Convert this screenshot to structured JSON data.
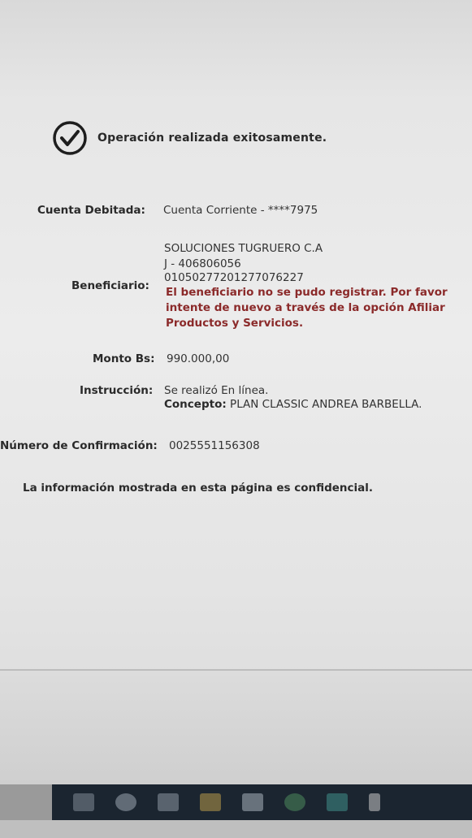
{
  "status": {
    "icon": "check-circle-icon",
    "message": "Operación realizada exitosamente."
  },
  "fields": {
    "cuenta_label": "Cuenta Debitada:",
    "cuenta_value": "Cuenta Corriente - ****7975",
    "beneficiario_label": "Beneficiario:",
    "beneficiario_name": "SOLUCIONES TUGRUERO C.A",
    "beneficiario_rif": "J - 406806056",
    "beneficiario_account": "01050277201277076227",
    "beneficiario_warning": "El beneficiario no se pudo registrar. Por favor intente de nuevo a través de la opción Afiliar Productos y Servicios.",
    "monto_label": "Monto Bs:",
    "monto_value": "990.000,00",
    "instruccion_label": "Instrucción:",
    "instruccion_value": "Se realizó En línea.",
    "concepto_label": "Concepto:",
    "concepto_value": "PLAN CLASSIC ANDREA BARBELLA.",
    "confirmacion_label": "Número de Confirmación:",
    "confirmacion_value": "0025551156308"
  },
  "footer": {
    "note": "La información mostrada en esta página es confidencial."
  },
  "taskbar": {
    "items": [
      "start-icon",
      "search-icon",
      "file-explorer-icon",
      "folder-icon",
      "app-icon",
      "chrome-icon",
      "store-icon",
      "app2-icon"
    ]
  },
  "colors": {
    "warning": "#8b2a2a",
    "text": "#2b2b2b",
    "taskbar": "#1b2530"
  }
}
